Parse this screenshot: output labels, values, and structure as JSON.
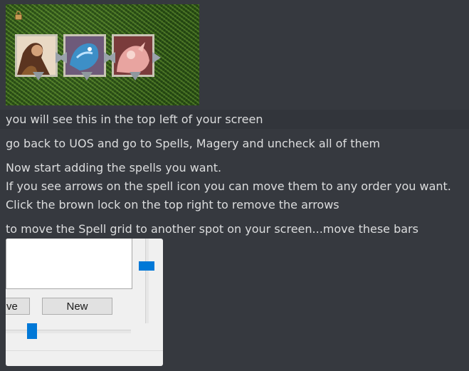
{
  "game_screenshot": {
    "spells": [
      {
        "icon": "warrior-spell-icon"
      },
      {
        "icon": "blue-dragon-spell-icon"
      },
      {
        "icon": "pink-creature-spell-icon"
      }
    ],
    "lock_icon": "brown-lock-icon",
    "colors": {
      "grass": "#3a6a22",
      "frame": "#c8c4b5",
      "arrow": "#9aa3ab"
    }
  },
  "messages": [
    "you will see this in the top left of your screen",
    "go back to UOS and go to Spells, Magery and uncheck all of them",
    "Now start adding the spells you want.",
    "If you see arrows on the spell icon you can move them to any order you want.",
    "Click the brown lock on the top right to remove the arrows",
    "to move the Spell grid to another spot on your screen...move these bars"
  ],
  "settings_screenshot": {
    "buttons": {
      "partial_label": "ve",
      "new_label": "New"
    },
    "accent_color": "#0078d7"
  }
}
